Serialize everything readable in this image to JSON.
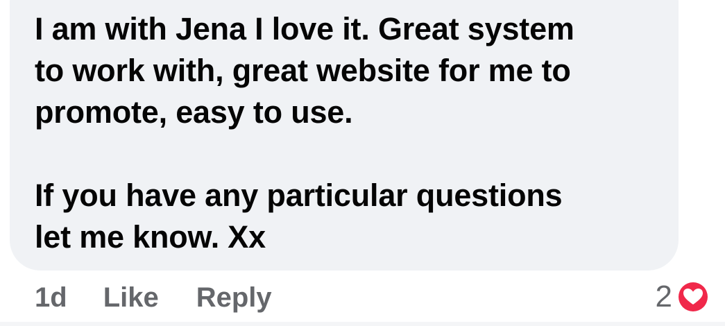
{
  "comment": {
    "paragraph_1_lines": [
      "I am with Jena I love it. Great system",
      "to work with, great website for me to",
      "promote, easy to use."
    ],
    "paragraph_2_lines": [
      "If you have any particular questions",
      "let me know. Xx"
    ]
  },
  "actions": {
    "timestamp": "1d",
    "like_label": "Like",
    "reply_label": "Reply"
  },
  "reactions": {
    "count": "2",
    "icon": "heart-icon",
    "heart_color": "#f0284a"
  },
  "colors": {
    "bubble_bg": "#f0f2f5",
    "text": "#050505",
    "secondary_text": "#65676b"
  }
}
